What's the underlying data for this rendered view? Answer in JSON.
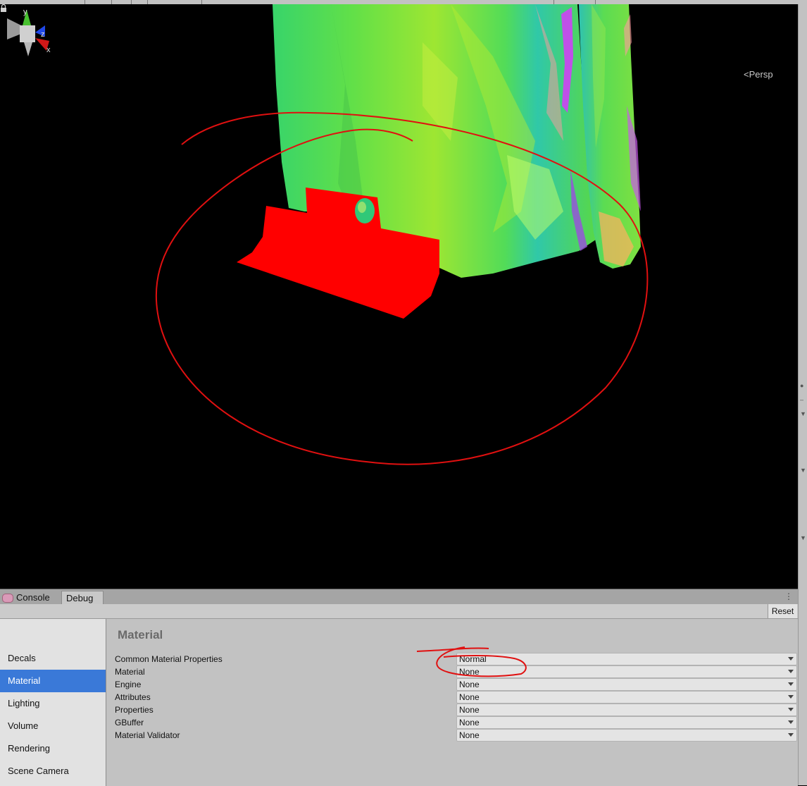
{
  "scene": {
    "camera_mode": "Persp",
    "gizmo_axes": {
      "y": "y",
      "z": "z",
      "x": "x"
    }
  },
  "panel": {
    "tabs": [
      {
        "label": "Console",
        "icon": "console-icon"
      },
      {
        "label": "Debug"
      }
    ],
    "reset_label": "Reset",
    "sidebar": [
      {
        "label": "Decals"
      },
      {
        "label": "Material",
        "active": true
      },
      {
        "label": "Lighting"
      },
      {
        "label": "Volume"
      },
      {
        "label": "Rendering"
      },
      {
        "label": "Scene Camera"
      }
    ],
    "section_title": "Material",
    "properties": [
      {
        "label": "Common Material Properties",
        "value": "Normal"
      },
      {
        "label": "Material",
        "value": "None"
      },
      {
        "label": "Engine",
        "value": "None"
      },
      {
        "label": "Attributes",
        "value": "None"
      },
      {
        "label": "Properties",
        "value": "None"
      },
      {
        "label": "GBuffer",
        "value": "None"
      },
      {
        "label": "Material Validator",
        "value": "None"
      }
    ]
  },
  "colors": {
    "active_item": "#3a79d8",
    "annotation": "#e01010",
    "decal": "#ff0000"
  }
}
